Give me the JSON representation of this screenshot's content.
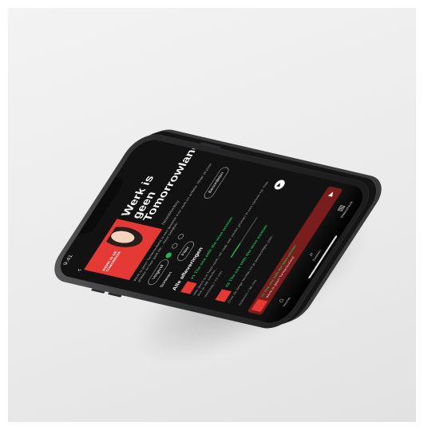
{
  "podcast": {
    "title": "Werk is geen Tomorrowland",
    "publisher": "NewsMonkey",
    "cover_text": "WERK IS GEEN TOMORROWLAND",
    "description": "Werk is geen Tomorrowland is een gesprek over werk en ambitie. Waar zit jouw ambitie en hoe gaat die... meer bekijken",
    "follow_label": "Volgend",
    "about_label": "Beoordelen",
    "sort_label": "Sorteren",
    "filter_label": "Filter"
  },
  "episodes_section": {
    "title": "Alle afleveringen"
  },
  "episodes": [
    {
      "title": "#1 The one with the wise woman",
      "text": "Wie goed is in haar werk, wil vaak ook verder groeien in een nieuwe rol. Hoe doe je dat zonder...",
      "meta": "Vandaag • 44 min",
      "progress": 0.35
    },
    {
      "title": "#2 The one with the wise woman",
      "text": "Over de lange termijn en je persoonlijke visie.",
      "meta": "Gisteren • 38 min",
      "progress": 0.0
    }
  ],
  "mini_player": {
    "title": "#1 The one with the wise woman",
    "subtitle": "Werk is geen Tomorrowland"
  },
  "status_bar": {
    "time": "9:41"
  },
  "tabs": [
    {
      "icon": "home-icon",
      "label": "Home"
    },
    {
      "icon": "search-icon",
      "label": "Zoeken"
    },
    {
      "icon": "library-icon",
      "label": "Bibliotheek"
    }
  ],
  "colors": {
    "accent": "#1db954",
    "cover": "#e53935",
    "player": "#7a1d1d"
  }
}
